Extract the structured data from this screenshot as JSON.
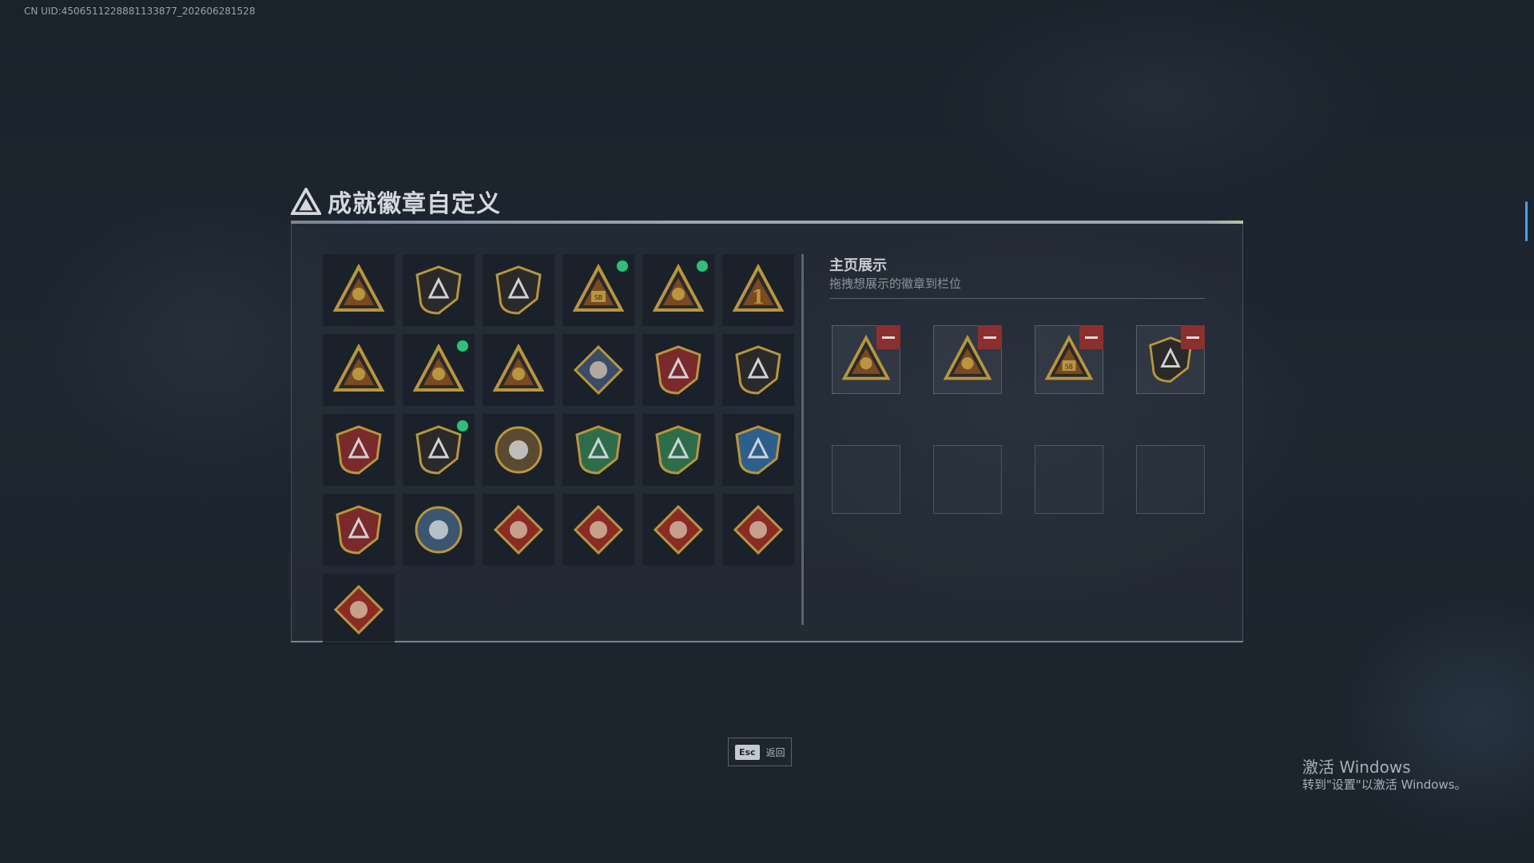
{
  "uid": "CN UID:4506511228881133877_202606281528",
  "page": {
    "title": "成就徽章自定义"
  },
  "display": {
    "title": "主页展示",
    "subtitle": "拖拽想展示的徽章到栏位"
  },
  "badges": [
    {
      "icon": "triangle-shield-badge-icon",
      "dot": false
    },
    {
      "icon": "helicopter-badge-icon",
      "dot": false
    },
    {
      "icon": "arrow-shield-badge-icon",
      "dot": false
    },
    {
      "icon": "sb-triangle-badge-icon",
      "dot": true
    },
    {
      "icon": "helmet-triangle-badge-icon",
      "dot": true
    },
    {
      "icon": "number-one-badge-icon",
      "dot": false
    },
    {
      "icon": "supply-triangle-badge-icon",
      "dot": false
    },
    {
      "icon": "soldier-triangle-badge-icon",
      "dot": true
    },
    {
      "icon": "squad-triangle-badge-icon",
      "dot": false
    },
    {
      "icon": "rocket-diamond-badge-icon",
      "dot": false
    },
    {
      "icon": "skull-star-badge-icon",
      "dot": false
    },
    {
      "icon": "shield-emblem-badge-icon",
      "dot": false
    },
    {
      "icon": "star-crest-badge-icon",
      "dot": false
    },
    {
      "icon": "lion-shield-badge-icon",
      "dot": true
    },
    {
      "icon": "crosshair-skull-badge-icon",
      "dot": false
    },
    {
      "icon": "green-skull-badge-icon",
      "dot": false
    },
    {
      "icon": "green-rifle-shield-badge-icon",
      "dot": false
    },
    {
      "icon": "blue-rifle-shield-badge-icon",
      "dot": false
    },
    {
      "icon": "gold-crest-badge-icon",
      "dot": false
    },
    {
      "icon": "eagle-badge-icon",
      "dot": false
    },
    {
      "icon": "red-dragon-badge-icon",
      "dot": false
    },
    {
      "icon": "red-beast-badge-icon",
      "dot": false
    },
    {
      "icon": "red-runner-badge-icon",
      "dot": false
    },
    {
      "icon": "red-wolf-badge-icon",
      "dot": false
    },
    {
      "icon": "red-sword-badge-icon",
      "dot": false
    }
  ],
  "displayed": [
    {
      "icon": "soldier-triangle-badge-icon"
    },
    {
      "icon": "helmet-triangle-badge-icon"
    },
    {
      "icon": "sb-triangle-badge-icon"
    },
    {
      "icon": "lion-shield-badge-icon"
    }
  ],
  "esc": {
    "key": "Esc",
    "label": "返回"
  },
  "windows": {
    "title": "激活 Windows",
    "subtitle": "转到\"设置\"以激活 Windows。"
  },
  "colors": {
    "badge_gold": "#b8953f",
    "badge_dark": "#2a2a2a",
    "badge_red": "#8a2b25",
    "badge_green": "#2f6d4a",
    "badge_blue": "#2e5f8a",
    "notify_dot": "#2fbf7c",
    "remove_red": "#8c2f2f"
  }
}
